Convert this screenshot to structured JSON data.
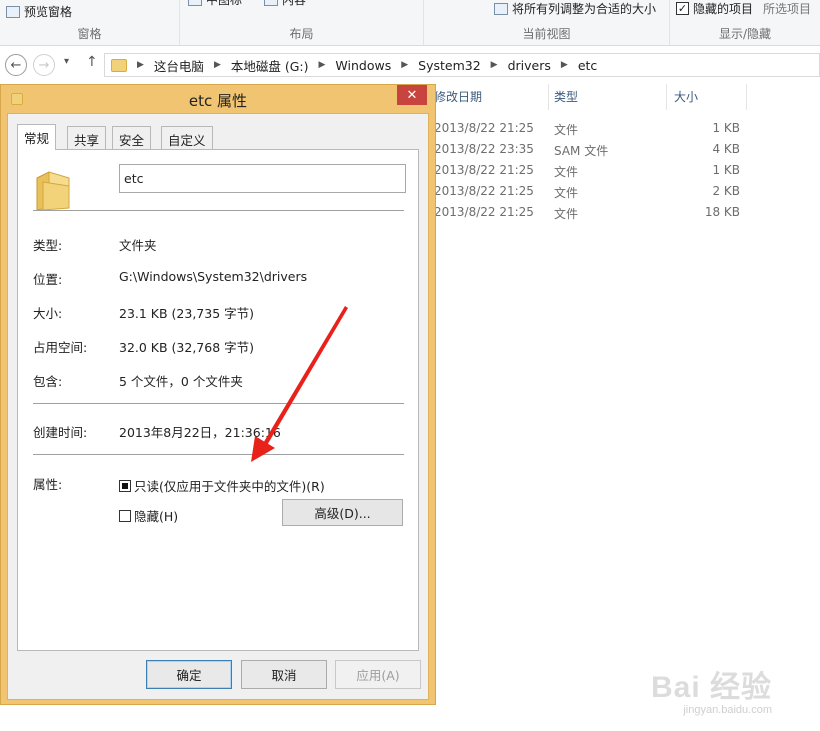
{
  "ribbon": {
    "preview_pane": "预览窗格",
    "group_pane": "窗格",
    "group_layout": "布局",
    "layout_item1": "中图标",
    "layout_item2": "内容",
    "resize_all": "将所有列调整为合适的大小",
    "group_current_view": "当前视图",
    "hidden_items": "隐藏的项目",
    "hidden_items_checked": true,
    "selected_items": "所选项目",
    "group_show_hide": "显示/隐藏"
  },
  "address": {
    "crumbs": [
      "这台电脑",
      "本地磁盘 (G:)",
      "Windows",
      "System32",
      "drivers",
      "etc"
    ]
  },
  "filelist": {
    "headers": {
      "modified": "修改日期",
      "type": "类型",
      "size": "大小"
    },
    "rows": [
      {
        "modified": "2013/8/22 21:25",
        "type": "文件",
        "size": "1 KB"
      },
      {
        "modified": "2013/8/22 23:35",
        "type": "SAM 文件",
        "size": "4 KB"
      },
      {
        "modified": "2013/8/22 21:25",
        "type": "文件",
        "size": "1 KB"
      },
      {
        "modified": "2013/8/22 21:25",
        "type": "文件",
        "size": "2 KB"
      },
      {
        "modified": "2013/8/22 21:25",
        "type": "文件",
        "size": "18 KB"
      }
    ]
  },
  "dialog": {
    "title": "etc 属性",
    "close": "✕",
    "tabs": [
      "常规",
      "共享",
      "安全",
      "自定义"
    ],
    "name": "etc",
    "props": {
      "type_label": "类型:",
      "type_value": "文件夹",
      "location_label": "位置:",
      "location_value": "G:\\Windows\\System32\\drivers",
      "size_label": "大小:",
      "size_value": "23.1 KB (23,735 字节)",
      "disk_label": "占用空间:",
      "disk_value": "32.0 KB (32,768 字节)",
      "contains_label": "包含:",
      "contains_value": "5 个文件，0 个文件夹",
      "created_label": "创建时间:",
      "created_value": "2013年8月22日，21:36:16",
      "attrs_label": "属性:"
    },
    "readonly_label": "只读(仅应用于文件夹中的文件)(R)",
    "readonly_state": "indeterminate",
    "hidden_label": "隐藏(H)",
    "hidden_checked": false,
    "advanced": "高级(D)...",
    "ok": "确定",
    "cancel": "取消",
    "apply": "应用(A)"
  },
  "watermark": {
    "main": "Bai 经验",
    "sub": "jingyan.baidu.com"
  }
}
